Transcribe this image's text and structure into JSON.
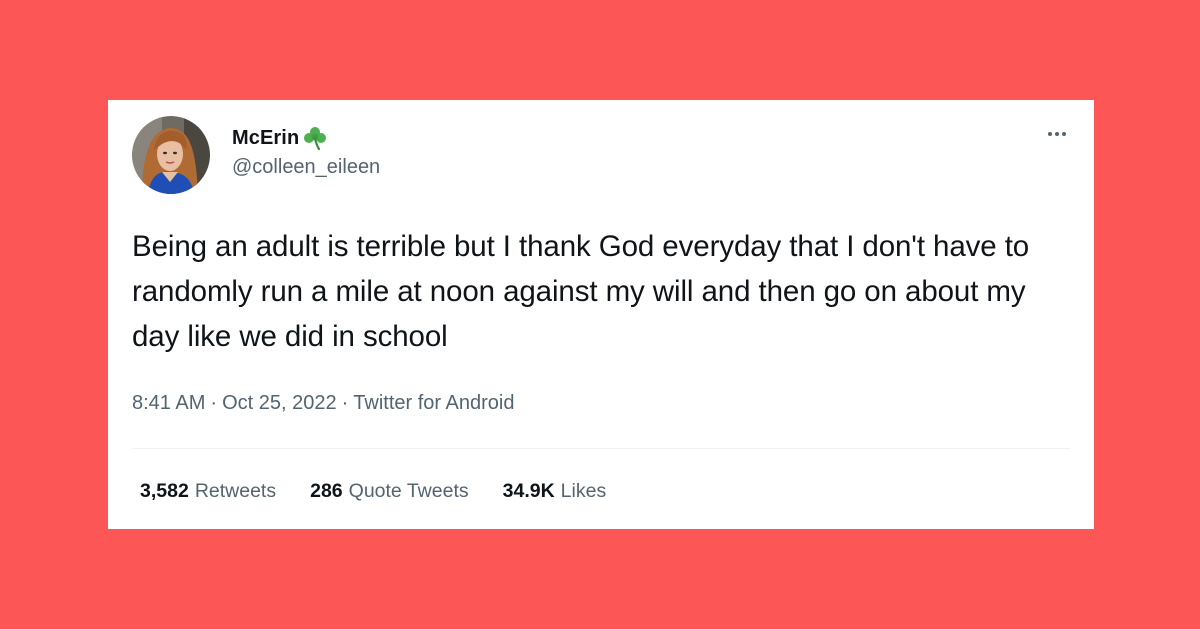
{
  "tweet": {
    "author": {
      "display_name": "McErin",
      "emoji_icon": "shamrock-icon",
      "handle": "@colleen_eileen"
    },
    "text": "Being an adult is terrible but I thank God everyday that I don't have to randomly run a mile at noon against my will and then go on about my day like we did in school",
    "timestamp_time": "8:41 AM",
    "timestamp_date": "Oct 25, 2022",
    "source": "Twitter for Android",
    "separator": "·",
    "stats": {
      "retweets_count": "3,582",
      "retweets_label": "Retweets",
      "quotes_count": "286",
      "quotes_label": "Quote Tweets",
      "likes_count": "34.9K",
      "likes_label": "Likes"
    }
  },
  "colors": {
    "background": "#FD5656",
    "card": "#FFFFFF",
    "primary_text": "#0F1419",
    "secondary_text": "#536471",
    "shamrock": "#4CAF50"
  }
}
